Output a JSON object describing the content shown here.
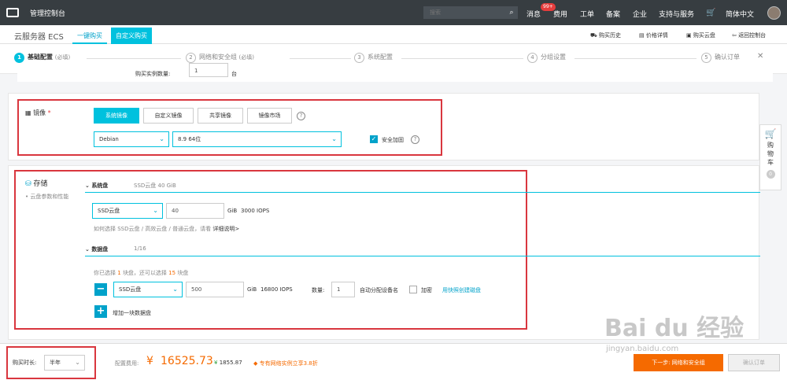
{
  "topbar": {
    "console": "管理控制台",
    "search_placeholder": "搜索",
    "badge": "99+",
    "nav": [
      "消息",
      "费用",
      "工单",
      "备案",
      "企业",
      "支持与服务"
    ],
    "lang": "简体中文"
  },
  "subbar": {
    "product": "云服务器 ECS",
    "tab_quick": "一键购买",
    "tab_custom": "自定义购买",
    "links": [
      "购买历史",
      "价格详情",
      "购买云盘",
      "返回控制台"
    ]
  },
  "steps": [
    {
      "num": "1",
      "label": "基础配置",
      "note": "(必填)"
    },
    {
      "num": "2",
      "label": "网络和安全组",
      "note": "(必填)"
    },
    {
      "num": "3",
      "label": "系统配置",
      "note": ""
    },
    {
      "num": "4",
      "label": "分组设置",
      "note": ""
    },
    {
      "num": "5",
      "label": "确认订单",
      "note": ""
    }
  ],
  "top_fragment": {
    "label": "购买实例数量:",
    "value": "1",
    "unit": "台"
  },
  "image": {
    "title": "镜像",
    "required_mark": "*",
    "tabs": [
      "系统镜像",
      "自定义镜像",
      "共享镜像",
      "镜像市场"
    ],
    "os": "Debian",
    "version": "8.9 64位",
    "security": "安全加固"
  },
  "storage": {
    "title": "存储",
    "subnote": "云盘参数和性能",
    "system": {
      "title": "系统盘",
      "summary": "SSD云盘  40 GiB",
      "type": "SSD云盘",
      "size": "40",
      "unit": "GiB",
      "iops": "3000 IOPS",
      "help_text": "如何选择 SSD云盘 / 高效云盘 / 普通云盘，请看",
      "help_link": "详细说明>"
    },
    "data": {
      "title": "数据盘",
      "count": "1/16",
      "chosen_prefix": "你已选择",
      "chosen_n": "1",
      "chosen_mid": "块盘，还可以选择",
      "chosen_remain": "15",
      "chosen_suffix": "块盘",
      "type": "SSD云盘",
      "size": "500",
      "unit": "GiB",
      "iops": "16800 IOPS",
      "qty_label": "数量:",
      "qty": "1",
      "auto": "自动分配设备名",
      "encrypt": "加密",
      "snapshot": "用快照创建磁盘",
      "add": "增加一块数据盘"
    }
  },
  "bottom": {
    "duration_label": "购买时长:",
    "duration": "半年",
    "fee_label": "配置费用:",
    "currency": "¥",
    "price": "16525.73",
    "saving_icon": "¥",
    "saving": "1855.87",
    "promo": "专有网络实例立享3.8折",
    "next": "下一步: 网络和安全组",
    "confirm": "确认订单"
  },
  "cart": {
    "chars": [
      "购",
      "物",
      "车"
    ],
    "count": "0"
  },
  "watermark": {
    "logo": "Bai du 经验",
    "url": "jingyan.baidu.com"
  }
}
